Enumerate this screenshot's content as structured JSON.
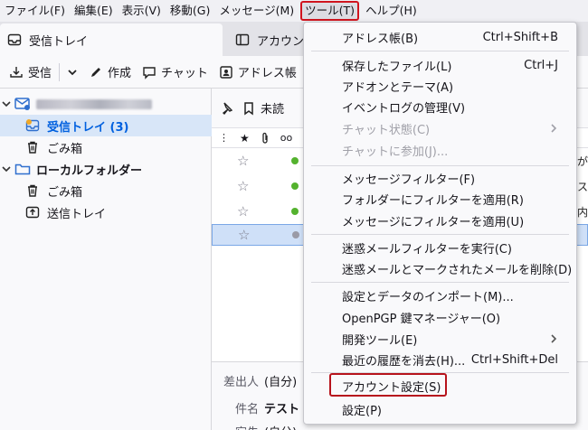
{
  "menubar": {
    "items": [
      "ファイル(F)",
      "編集(E)",
      "表示(V)",
      "移動(G)",
      "メッセージ(M)",
      "ツール(T)",
      "ヘルプ(H)"
    ]
  },
  "tabs": [
    "受信トレイ",
    "アカウント"
  ],
  "toolbar": {
    "get_messages": "受信",
    "write": "作成",
    "chat": "チャット",
    "address_book": "アドレス帳"
  },
  "folders": {
    "items": [
      {
        "label": "受信トレイ (3)"
      },
      {
        "label": "ごみ箱"
      },
      {
        "label": "ローカルフォルダー"
      },
      {
        "label": "ごみ箱"
      },
      {
        "label": "送信トレイ"
      }
    ]
  },
  "list": {
    "filter_label": "未読",
    "right_fragments": [
      "が",
      "テス",
      "内"
    ]
  },
  "header": {
    "from_label": "差出人",
    "from_value": "(自分)",
    "subject_label": "件名",
    "subject_value": "テスト",
    "to_label": "宛先",
    "to_value": "(自分)"
  },
  "tools_menu": {
    "items": [
      {
        "label": "アドレス帳(B)",
        "shortcut": "Ctrl+Shift+B"
      },
      {
        "label": "保存したファイル(L)",
        "shortcut": "Ctrl+J"
      },
      {
        "label": "アドオンとテーマ(A)",
        "shortcut": ""
      },
      {
        "label": "イベントログの管理(V)",
        "shortcut": ""
      },
      {
        "label": "チャット状態(C)",
        "shortcut": ""
      },
      {
        "label": "チャットに参加(J)...",
        "shortcut": ""
      },
      {
        "label": "メッセージフィルター(F)",
        "shortcut": ""
      },
      {
        "label": "フォルダーにフィルターを適用(R)",
        "shortcut": ""
      },
      {
        "label": "メッセージにフィルターを適用(U)",
        "shortcut": ""
      },
      {
        "label": "迷惑メールフィルターを実行(C)",
        "shortcut": ""
      },
      {
        "label": "迷惑メールとマークされたメールを削除(D)",
        "shortcut": ""
      },
      {
        "label": "設定とデータのインポート(M)...",
        "shortcut": ""
      },
      {
        "label": "OpenPGP 鍵マネージャー(O)",
        "shortcut": ""
      },
      {
        "label": "開発ツール(E)",
        "shortcut": ""
      },
      {
        "label": "最近の履歴を消去(H)...",
        "shortcut": "Ctrl+Shift+Del"
      },
      {
        "label": "アカウント設定(S)",
        "shortcut": ""
      },
      {
        "label": "設定(P)",
        "shortcut": ""
      }
    ]
  },
  "colors": {
    "highlight_border": "#d0141e",
    "selected_folder_text": "#0060df",
    "selected_row": "#cfe0f8"
  }
}
